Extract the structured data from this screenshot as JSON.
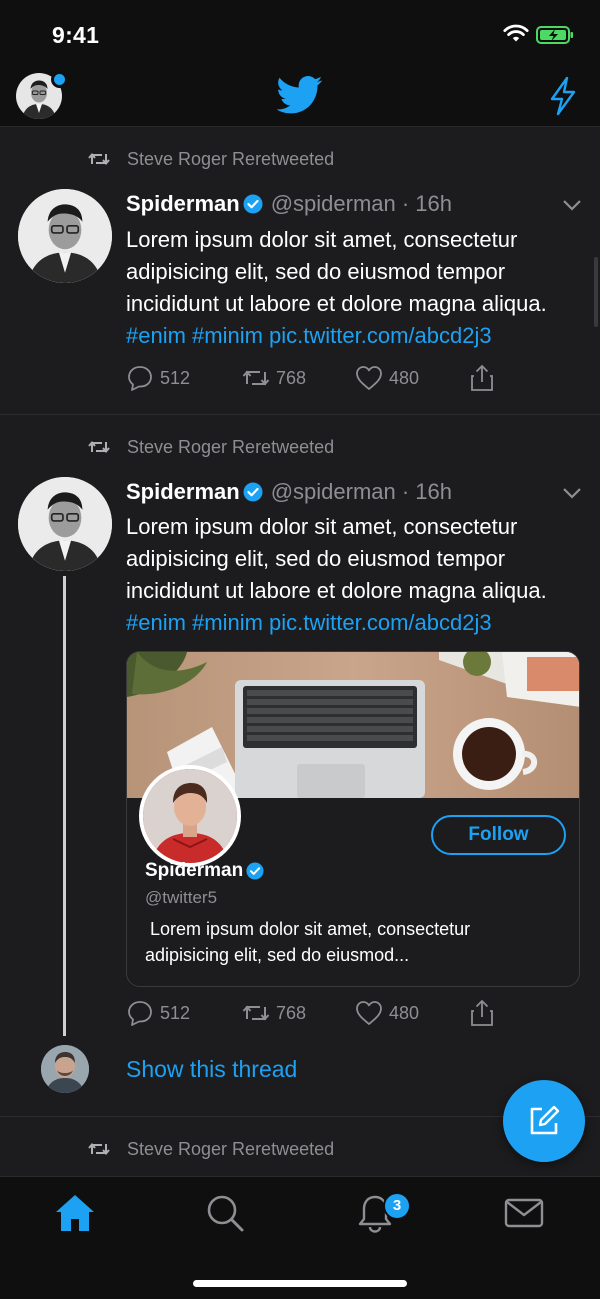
{
  "status_bar": {
    "time": "9:41"
  },
  "colors": {
    "accent": "#1da1f2",
    "background": "#1c1c1e",
    "bar": "#0f0f10",
    "muted": "#8e8e93",
    "battery": "#4cd964"
  },
  "nav": {
    "logo": "twitter-bird-icon",
    "right_icon": "lightning-bolt-icon"
  },
  "tweets": [
    {
      "retweeted_by": "Steve Roger Reretweeted",
      "name": "Spiderman",
      "handle": "@spiderman · 16h",
      "text_lines": [
        "Lorem ipsum dolor sit amet, consectetur",
        "adipisicing elit, sed do eiusmod tempor",
        "incididunt ut labore et dolore magna aliqua."
      ],
      "tags": "#enim #minim pic.twitter.com/abcd2j3",
      "replies": "512",
      "retweets": "768",
      "likes": "480"
    },
    {
      "retweeted_by": "Steve Roger Reretweeted",
      "name": "Spiderman",
      "handle": "@spiderman · 16h",
      "text_lines": [
        "Lorem ipsum dolor sit amet, consectetur",
        "adipisicing elit, sed do eiusmod tempor",
        "incididunt ut labore et dolore magna aliqua."
      ],
      "tags": "#enim #minim pic.twitter.com/abcd2j3",
      "card": {
        "follow_label": "Follow",
        "name": "Spiderman",
        "handle": "@twitter5",
        "desc_line1": " Lorem ipsum dolor sit amet, consectetur",
        "desc_line2": "adipisicing elit, sed do eiusmod..."
      },
      "replies": "512",
      "retweets": "768",
      "likes": "480",
      "show_thread": "Show this thread"
    },
    {
      "retweeted_by": "Steve Roger Reretweeted"
    }
  ],
  "tab_bar": {
    "items": [
      "home-icon",
      "search-icon",
      "notifications-icon",
      "messages-icon"
    ],
    "notifications_badge": "3"
  }
}
